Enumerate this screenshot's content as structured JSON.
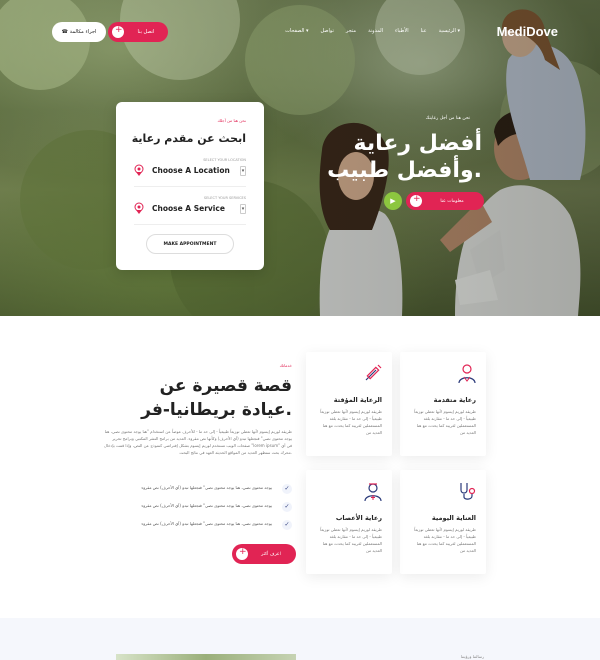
{
  "brand": {
    "logo": "MediDove",
    "accent": "#e12454",
    "green": "#8cc63f"
  },
  "nav": {
    "menu": [
      "الرئيسية ▾",
      "عنا",
      "الأطباء",
      "المدونة",
      "متجر",
      "تواصل",
      "الصفحات ▾"
    ],
    "contact_label": "اتصل بنا",
    "call_label": "اجراء مكالمة"
  },
  "search_card": {
    "kicker": "نحن هنا من أجلك",
    "title": "ابحث عن مقدم رعاية",
    "location": {
      "sub": "SELECT YOUR LOCATION",
      "value": "Choose A Location"
    },
    "service": {
      "sub": "SELECT YOUR SERVICES",
      "value": "Choose A Service"
    },
    "button": "MAKE APPOINTMENT"
  },
  "hero": {
    "kicker": "نحن هنا من أجل رعايتك",
    "title": "أفضل رعاية وأفضل طبيب.",
    "button": "معلومات عنا"
  },
  "services": [
    {
      "name": "رعاية متقدمة",
      "desc": "طريقة لوريم إيسوم لأنها تعطي توزيعاً طبيعياً - إلى حد ما - ",
      "extra": "مقارنة بلغة المستعملين لغريبة كما يحدث مع هنا العديد من",
      "icon": "doctor-icon"
    },
    {
      "name": "الرعاية المؤقتة",
      "desc": "طريقة لوريم إيسوم لأنها تعطي توزيعاً طبيعياً - إلى حد ما - ",
      "extra": "مقارنة بلغة المستعملين لغريبة كما يحدث مع هنا العديد من",
      "icon": "syringe-icon"
    },
    {
      "name": "العناية اليومية",
      "desc": "طريقة لوريم إيسوم لأنها تعطي توزيعاً طبيعياً - إلى حد ما - ",
      "extra": "مقارنة بلغة المستعملين لغريبة كما يحدث مع هنا العديد من",
      "icon": "stethoscope-icon"
    },
    {
      "name": "رعاية الأعصاب",
      "desc": "طريقة لوريم إيسوم لأنها تعطي توزيعاً طبيعياً - إلى حد ما - ",
      "extra": "مقارنة بلغة المستعملين لغريبة كما يحدث مع هنا العديد من",
      "icon": "nurse-icon"
    }
  ],
  "about": {
    "kicker": "خدماتك",
    "title": "قصة قصيرة عن عيادة بريطانيا-فر.",
    "body": "طريقة لوريم إيسوم لأنها تعطي توزيعاً طبيعياً - إلى حد ما - للأحرف عوضاً عن استخدام \"هنا يوجد محتوى نصي، هنا يوجد محتوى نصي\" فتجعلها تبدو (أي الأحرف) وكأنها نص مقروء. العديد من برامح النشر المكتبي وبرامح تحرير صفحات الويب تستخدم لوريم إيسوم بشكل إفتراضي كنموذج عن النص، وإذا قمت بإدخال \"lorem ipsum\" في أي محرك بحث ستظهر العديد من المواقع الحديثة العهد في نتائج البحث.",
    "checks": [
      "يوجد محتوى نصي، هنا يوجد محتوى نصي\" فتجعلها تبدو (أي الأحرف) نص مقروء",
      "يوجد محتوى نصي، هنا يوجد محتوى نصي\" فتجعلها تبدو (أي الأحرف) نص مقروء",
      "يوجد محتوى نصي، هنا يوجد محتوى نصي\" فتجعلها تبدو (أي الأحرف) نص مقروء"
    ],
    "button": "اعرف أكثر"
  },
  "bottom": {
    "kicker": "رسالتنا ورؤيتنا"
  }
}
